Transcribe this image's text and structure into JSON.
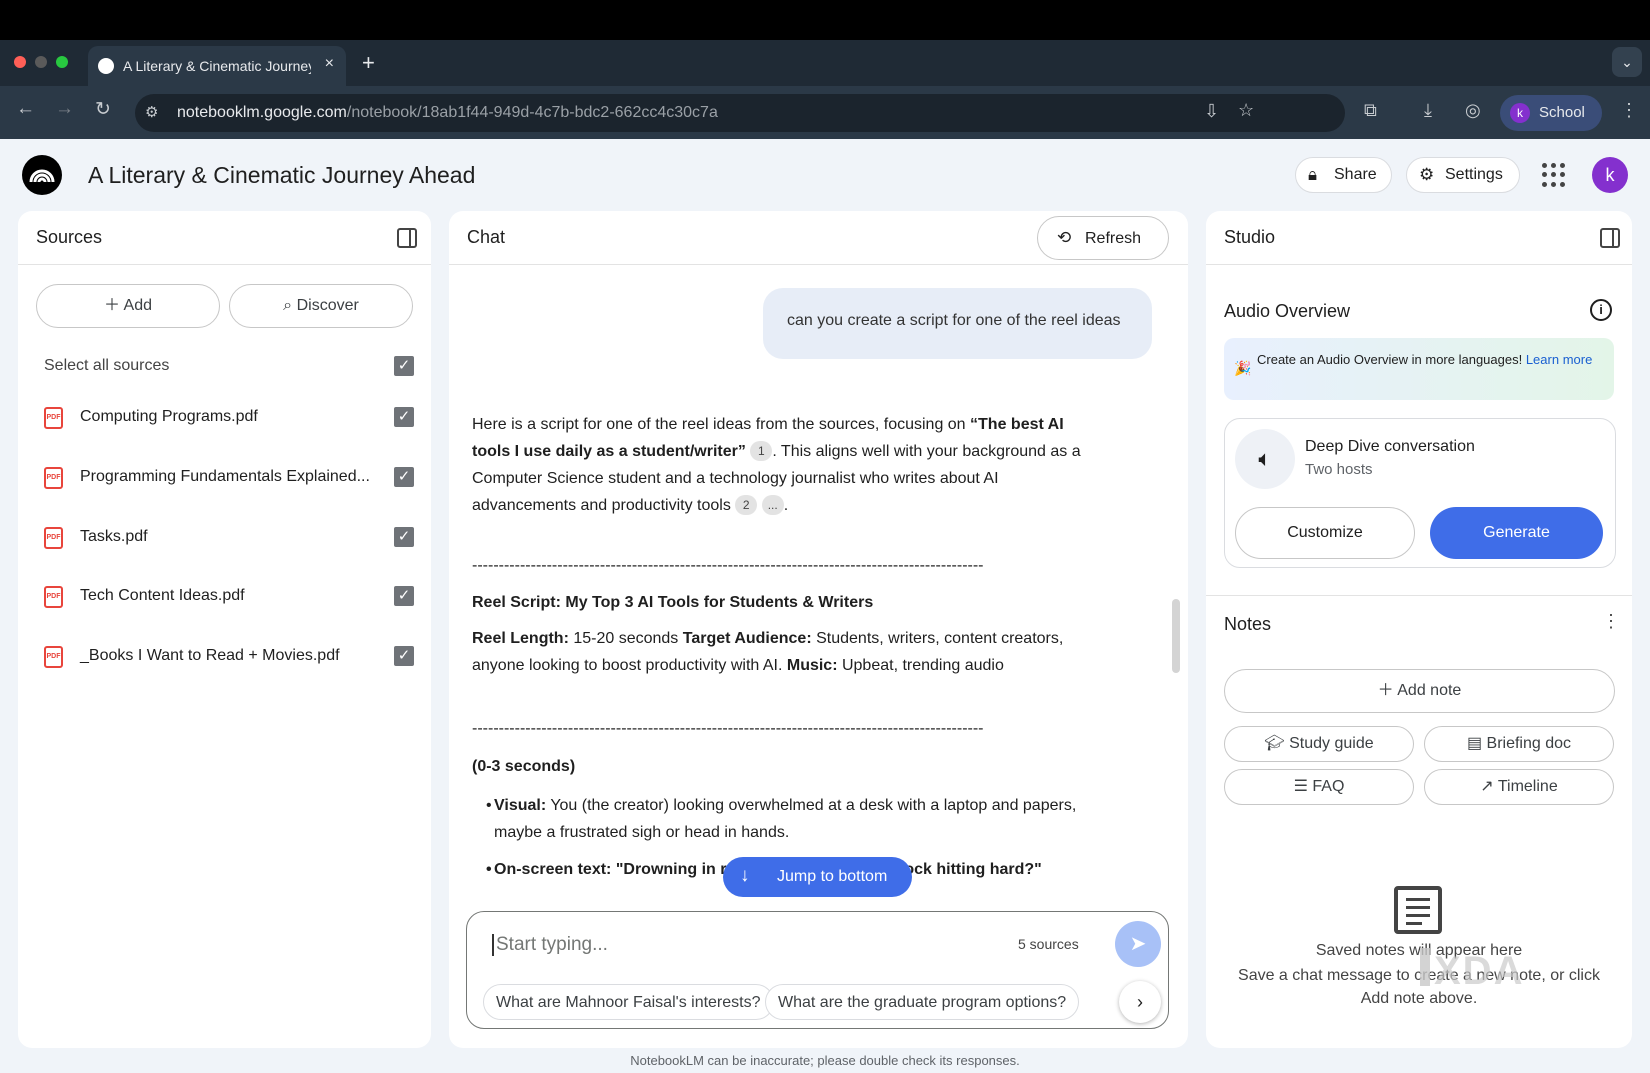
{
  "browser": {
    "tab_title": "A Literary & Cinematic Journey Ahead",
    "tab_close": "×",
    "new_tab": "+",
    "url_host": "notebooklm.google.com",
    "url_path": "/notebook/18ab1f44-949d-4c7b-bdc2-662cc4c30c7a",
    "profile_initial": "k",
    "profile_name": "School",
    "colors": {
      "close": "#ff5f57",
      "minimize": "#febc2e",
      "zoom": "#28c840"
    }
  },
  "app": {
    "title": "A Literary & Cinematic Journey Ahead",
    "share_label": "Share",
    "settings_label": "Settings",
    "user_initial": "k"
  },
  "sources": {
    "title": "Sources",
    "add_label": "Add",
    "discover_label": "Discover",
    "select_all_label": "Select all sources",
    "items": [
      {
        "name": "Computing Programs.pdf",
        "type": "PDF",
        "checked": true
      },
      {
        "name": "Programming Fundamentals Explained...",
        "type": "PDF",
        "checked": true
      },
      {
        "name": "Tasks.pdf",
        "type": "PDF",
        "checked": true
      },
      {
        "name": "Tech Content Ideas.pdf",
        "type": "PDF",
        "checked": true
      },
      {
        "name": "_Books I Want to Read + Movies.pdf",
        "type": "PDF",
        "checked": true
      }
    ]
  },
  "chat": {
    "title": "Chat",
    "refresh_label": "Refresh",
    "user_message": "can you create a script for one of the reel ideas",
    "response": {
      "intro_1": "Here is a script for one of the reel ideas from the sources, focusing on ",
      "intro_bold": "“The best AI tools I use daily as a student/writer”",
      "cite_1": "1",
      "intro_2": ". This aligns well with your background as a Computer Science student and a technology journalist who writes about AI advancements and productivity tools ",
      "cite_2": "2",
      "cite_more": "...",
      "intro_end": ".",
      "divider": "------------------------------------------------------------------------------------------------",
      "script_title": "Reel Script: My Top 3 AI Tools for Students & Writers",
      "length_label": "Reel Length:",
      "length_value": " 15-20 seconds ",
      "audience_label": "Target Audience:",
      "audience_value": " Students, writers, content creators, anyone looking to boost productivity with AI. ",
      "music_label": "Music:",
      "music_value": " Upbeat, trending audio",
      "section_1": "(0-3 seconds)",
      "visual_label": "Visual:",
      "visual_value": " You (the creator) looking overwhelmed at a desk with a laptop and papers, maybe a frustrated sigh or head in hands.",
      "onscreen_label": "On-screen text: \"Drowning in research\" or \"Writer's block hitting hard?\""
    },
    "jump_label": "Jump to bottom",
    "input_placeholder": "Start typing...",
    "source_count": "5 sources",
    "suggestions": [
      "What are Mahnoor Faisal's interests?",
      "What are the graduate program options?"
    ],
    "disclaimer": "NotebookLM can be inaccurate; please double check its responses."
  },
  "studio": {
    "title": "Studio",
    "audio_overview_title": "Audio Overview",
    "banner_text": "Create an Audio Overview in more languages! ",
    "banner_link": "Learn more",
    "deep_dive_title": "Deep Dive conversation",
    "deep_dive_subtitle": "Two hosts",
    "customize_label": "Customize",
    "generate_label": "Generate",
    "notes_title": "Notes",
    "add_note_label": "Add note",
    "note_buttons": [
      "Study guide",
      "Briefing doc",
      "FAQ",
      "Timeline"
    ],
    "empty_title": "Saved notes will appear here",
    "empty_subtitle": "Save a chat message to create a new note, or click Add note above."
  },
  "watermark": "XDA"
}
